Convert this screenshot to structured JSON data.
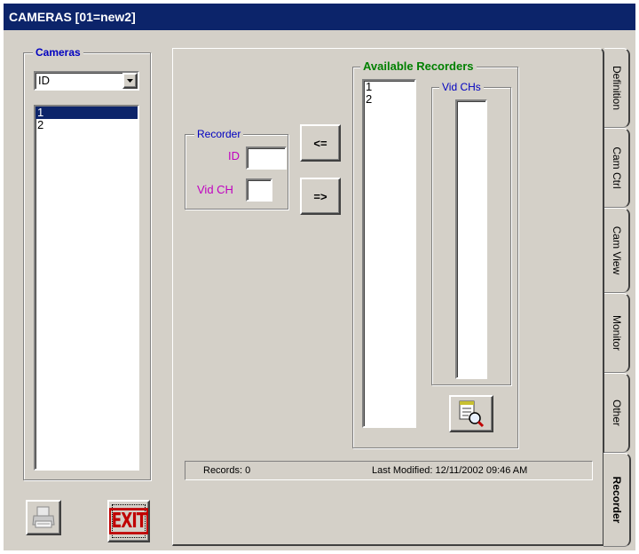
{
  "window": {
    "title": "CAMERAS [01=new2]"
  },
  "cameras": {
    "legend": "Cameras",
    "sort_value": "ID",
    "items": [
      "1",
      "2"
    ],
    "selected_index": 0
  },
  "recorder_group": {
    "legend": "Recorder",
    "id_label": "ID",
    "id_value": "",
    "vidch_label": "Vid CH",
    "vidch_value": ""
  },
  "buttons": {
    "assign_label": "<=",
    "unassign_label": "=>",
    "exit_label": "EXIT"
  },
  "available": {
    "legend": "Available Recorders",
    "items": [
      "1",
      "2"
    ],
    "vidchs_legend": "Vid CHs"
  },
  "status": {
    "records": "Records:  0",
    "last_modified": "Last Modified:  12/11/2002 09:46 AM"
  },
  "tabs": [
    "Definition",
    "Cam Ctrl",
    "Cam View",
    "Monitor",
    "Other",
    "Recorder"
  ],
  "active_tab": "Recorder",
  "colors": {
    "titlebar": "#0c246a",
    "legend_blue": "#0000c0",
    "legend_green": "#008000",
    "label_magenta": "#c000c0",
    "exit_red": "#c00000"
  },
  "icons": [
    "printer-icon",
    "find-icon",
    "dropdown-arrow-icon"
  ]
}
